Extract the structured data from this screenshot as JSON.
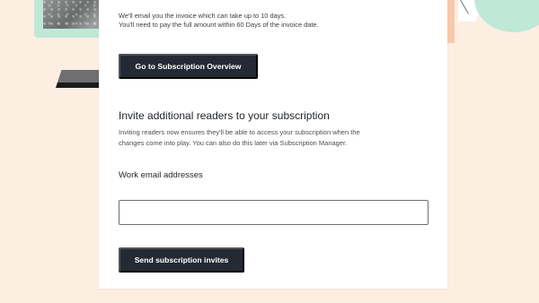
{
  "note": {
    "line1": "We'll email you the invoice which can take up to 10 days.",
    "line2": "You'll need to pay the full amount within 60 Days of the invoice date."
  },
  "buttons": {
    "overview_label": "Go to Subscription Overview",
    "send_invites_label": "Send subscription invites"
  },
  "invite_section": {
    "heading": "Invite additional readers to your subscription",
    "description_line1": "Inviting readers now ensures they'll be able to access your subscription when the",
    "description_line2": "changes come into play. You can also do this later via Subscription Manager."
  },
  "form": {
    "emails_label": "Work email addresses",
    "emails_value": "",
    "emails_placeholder": ""
  },
  "colors": {
    "page_background": "#fdeee2",
    "card_background": "#ffffff",
    "button_background": "#242a33",
    "button_text": "#ffffff",
    "accent_mint": "#bfe8d7"
  }
}
